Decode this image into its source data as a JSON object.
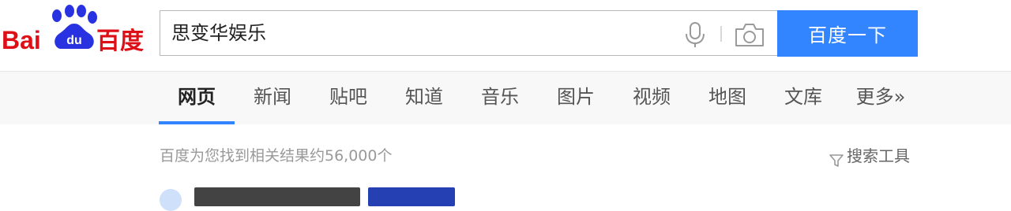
{
  "brand": {
    "logo_text": "Bai du 百度",
    "accent": "#3385ff",
    "logo_red": "#de0f17",
    "logo_blue": "#2932e1"
  },
  "search": {
    "query": "思变华娱乐",
    "placeholder": "",
    "mic_icon": "mic-icon",
    "camera_icon": "camera-icon",
    "button_label": "百度一下"
  },
  "tabs": [
    {
      "label": "网页",
      "active": true
    },
    {
      "label": "新闻"
    },
    {
      "label": "贴吧"
    },
    {
      "label": "知道"
    },
    {
      "label": "音乐"
    },
    {
      "label": "图片"
    },
    {
      "label": "视频"
    },
    {
      "label": "地图"
    },
    {
      "label": "文库"
    },
    {
      "label": "更多»"
    }
  ],
  "results": {
    "count_text": "百度为您找到相关结果约56,000个",
    "tools_label": "搜索工具",
    "tools_icon": "filter-icon"
  }
}
